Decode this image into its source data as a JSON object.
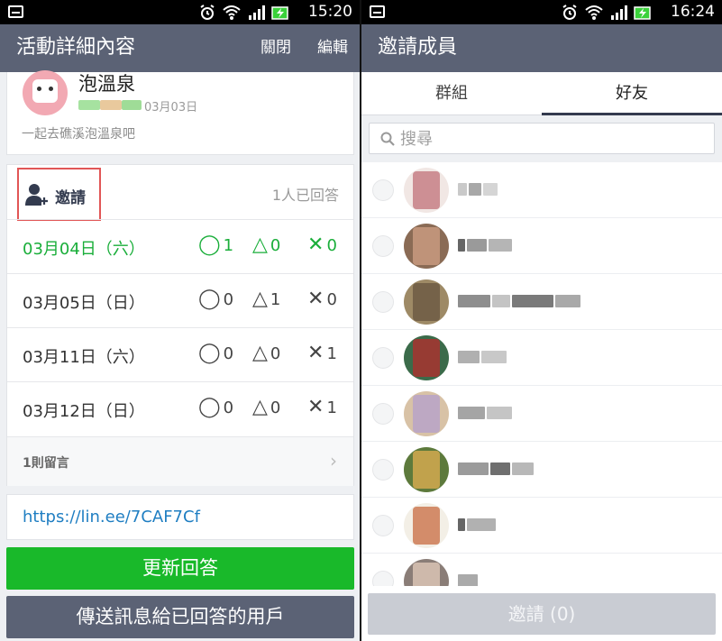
{
  "left": {
    "status": {
      "time": "15:20"
    },
    "appbar": {
      "title": "活動詳細內容",
      "close_label": "關閉",
      "edit_label": "編輯"
    },
    "event": {
      "title": "泡溫泉",
      "date": "03月03日",
      "description": "一起去礁溪泡溫泉吧"
    },
    "schedule": {
      "invite_label": "邀請",
      "answered_label": "1人已回答",
      "rows": [
        {
          "date": "03月04日（六）",
          "yes": "1",
          "maybe": "0",
          "no": "0"
        },
        {
          "date": "03月05日（日）",
          "yes": "0",
          "maybe": "1",
          "no": "0"
        },
        {
          "date": "03月11日（六）",
          "yes": "0",
          "maybe": "0",
          "no": "1"
        },
        {
          "date": "03月12日（日）",
          "yes": "0",
          "maybe": "0",
          "no": "1"
        }
      ],
      "symbols": {
        "yes": "◯",
        "maybe": "△",
        "no": "✕"
      },
      "comments_label": "1則留言"
    },
    "link": "https://lin.ee/7CAF7Cf",
    "update_button": "更新回答",
    "send_button": "傳送訊息給已回答的用戶"
  },
  "right": {
    "status": {
      "time": "16:24"
    },
    "appbar": {
      "title": "邀請成員"
    },
    "tabs": [
      "群組",
      "好友"
    ],
    "search": {
      "placeholder": "搜尋"
    },
    "invite_button": "邀請 (0)"
  },
  "colors": {
    "appbar": "#5b6275",
    "green": "#19b92a",
    "link": "#1f7ec2",
    "invite_highlight": "#e15656"
  }
}
